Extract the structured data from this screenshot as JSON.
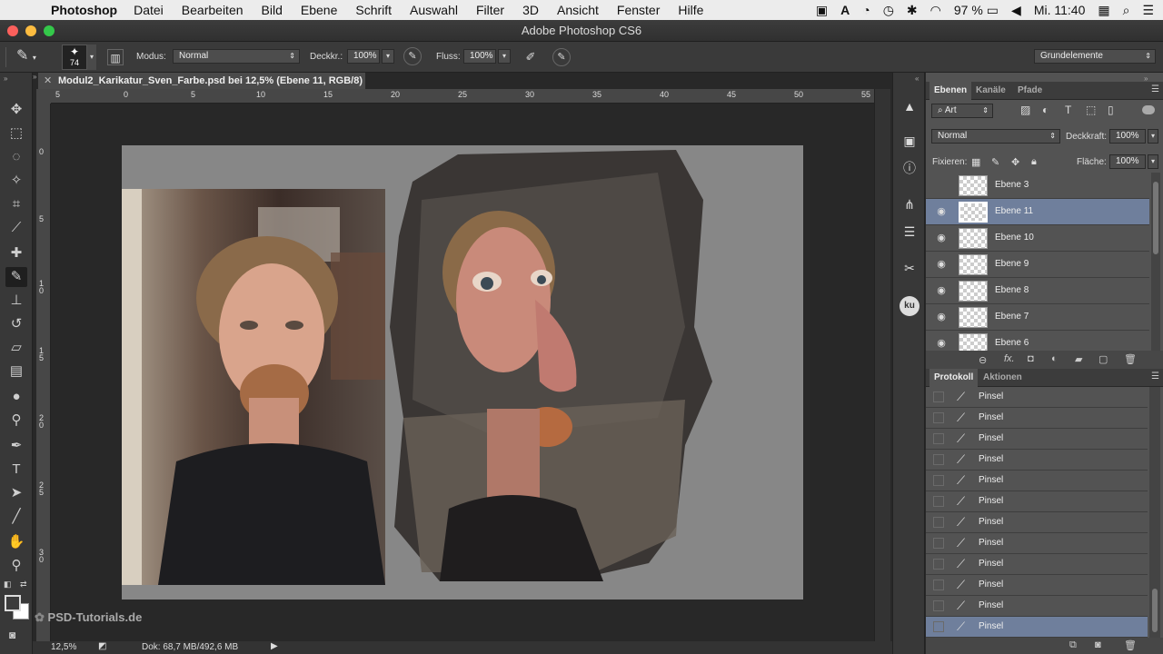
{
  "menubar": {
    "app": "Photoshop",
    "items": [
      "Datei",
      "Bearbeiten",
      "Bild",
      "Ebene",
      "Schrift",
      "Auswahl",
      "Filter",
      "3D",
      "Ansicht",
      "Fenster",
      "Hilfe"
    ],
    "battery": "97 %",
    "clock": "Mi. 11:40"
  },
  "window": {
    "title": "Adobe Photoshop CS6"
  },
  "options": {
    "brush_size": "74",
    "mode_label": "Modus:",
    "mode_value": "Normal",
    "opacity_label": "Deckkr.:",
    "opacity_value": "100%",
    "flow_label": "Fluss:",
    "flow_value": "100%",
    "workspace": "Grundelemente"
  },
  "document": {
    "tab_title": "Modul2_Karikatur_Sven_Farbe.psd bei 12,5% (Ebene 11, RGB/8) *",
    "ruler_h": [
      "5",
      "0",
      "5",
      "10",
      "15",
      "20",
      "25",
      "30",
      "35",
      "40",
      "45",
      "50",
      "55"
    ],
    "ruler_v": [
      "0",
      "5",
      "1 0",
      "1 5",
      "2 0",
      "2 5",
      "3 0"
    ],
    "zoom": "12,5%",
    "doc_info": "Dok: 68,7 MB/492,6 MB",
    "watermark": "PSD-Tutorials.de"
  },
  "layers_panel": {
    "tabs": [
      "Ebenen",
      "Kanäle",
      "Pfade"
    ],
    "filter_kind": "Art",
    "blend_mode": "Normal",
    "opacity_label": "Deckkraft:",
    "opacity_value": "100%",
    "lock_label": "Fixieren:",
    "fill_label": "Fläche:",
    "fill_value": "100%",
    "layers": [
      {
        "name": "Ebene 3",
        "visible": false,
        "selected": false
      },
      {
        "name": "Ebene 11",
        "visible": true,
        "selected": true
      },
      {
        "name": "Ebene 10",
        "visible": true,
        "selected": false
      },
      {
        "name": "Ebene 9",
        "visible": true,
        "selected": false
      },
      {
        "name": "Ebene 8",
        "visible": true,
        "selected": false
      },
      {
        "name": "Ebene 7",
        "visible": true,
        "selected": false
      },
      {
        "name": "Ebene 6",
        "visible": true,
        "selected": false
      }
    ]
  },
  "history_panel": {
    "tabs": [
      "Protokoll",
      "Aktionen"
    ],
    "items": [
      "Pinsel",
      "Pinsel",
      "Pinsel",
      "Pinsel",
      "Pinsel",
      "Pinsel",
      "Pinsel",
      "Pinsel",
      "Pinsel",
      "Pinsel",
      "Pinsel",
      "Pinsel"
    ],
    "selected_index": 11
  },
  "colors": {
    "selection": "#6f7f9c",
    "panel_bg": "#535353",
    "artboard": "#878787"
  }
}
